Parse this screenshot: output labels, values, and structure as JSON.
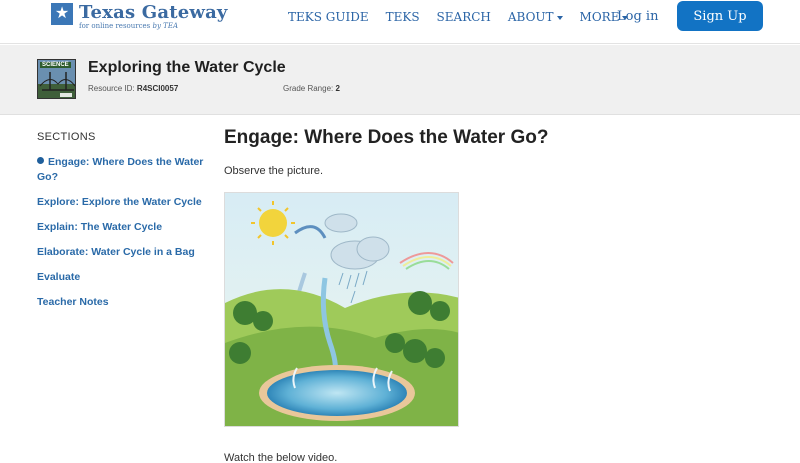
{
  "header": {
    "logo": {
      "title": "Texas Gateway",
      "subtitle_main": "for online resources",
      "subtitle_by": "by TEA"
    },
    "nav": [
      {
        "label": "TEKS GUIDE",
        "dropdown": false
      },
      {
        "label": "TEKS",
        "dropdown": false
      },
      {
        "label": "SEARCH",
        "dropdown": false
      },
      {
        "label": "ABOUT",
        "dropdown": true
      },
      {
        "label": "MORE",
        "dropdown": true
      }
    ],
    "login_label": "Log in",
    "signup_label": "Sign Up",
    "colors": {
      "brand": "#3b6aa1",
      "button": "#1273c4"
    }
  },
  "resource": {
    "thumbnail_label": "SCIENCE",
    "title": "Exploring the Water Cycle",
    "id_label": "Resource ID:",
    "id_value": "R4SCI0057",
    "grade_label": "Grade Range:",
    "grade_value": "2"
  },
  "sidebar": {
    "heading": "SECTIONS",
    "items": [
      {
        "label": "Engage: Where Does the Water Go?",
        "active": true
      },
      {
        "label": "Explore: Explore the Water Cycle",
        "active": false
      },
      {
        "label": "Explain: The Water Cycle",
        "active": false
      },
      {
        "label": "Elaborate: Water Cycle in a Bag",
        "active": false
      },
      {
        "label": "Evaluate",
        "active": false
      },
      {
        "label": "Teacher Notes",
        "active": false
      }
    ]
  },
  "main": {
    "title": "Engage: Where Does the Water Go?",
    "observe_text": "Observe the picture.",
    "watch_text": "Watch the below video."
  }
}
